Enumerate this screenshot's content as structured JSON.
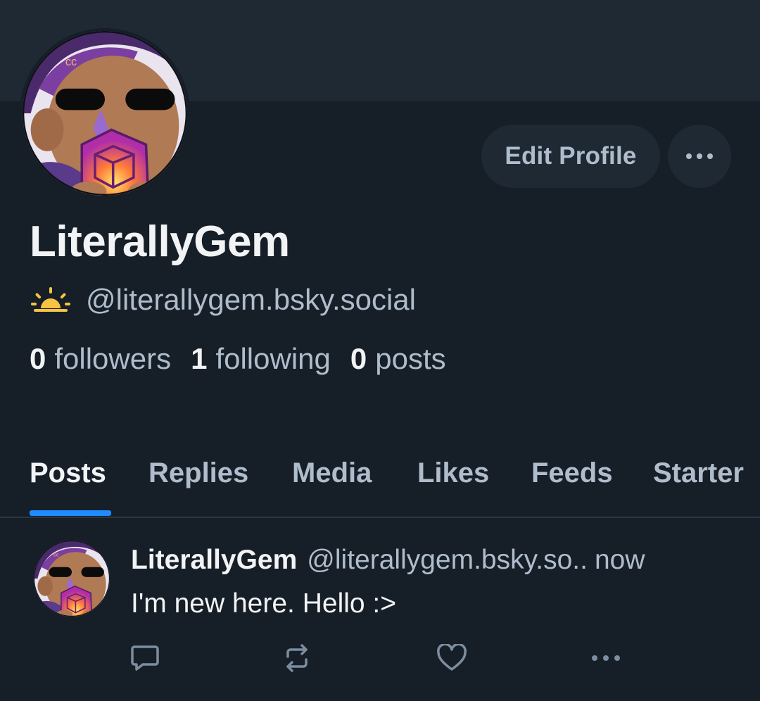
{
  "profile": {
    "display_name": "LiterallyGem",
    "handle": "@literallygem.bsky.social",
    "handle_emoji": "sunrise-icon",
    "edit_button_label": "Edit Profile",
    "more_button_icon": "ellipsis-icon"
  },
  "stats": {
    "followers_count": "0",
    "followers_label": "followers",
    "following_count": "1",
    "following_label": "following",
    "posts_count": "0",
    "posts_label": "posts"
  },
  "tabs": [
    {
      "label": "Posts",
      "active": true
    },
    {
      "label": "Replies",
      "active": false
    },
    {
      "label": "Media",
      "active": false
    },
    {
      "label": "Likes",
      "active": false
    },
    {
      "label": "Feeds",
      "active": false
    },
    {
      "label": "Starter",
      "active": false
    }
  ],
  "post": {
    "author_name": "LiterallyGem",
    "author_handle": "@literallygem.bsky.so..",
    "time": "now",
    "text": "I'm new here. Hello :>",
    "actions": [
      "reply-icon",
      "repost-icon",
      "like-icon",
      "more-icon"
    ]
  },
  "colors": {
    "background": "#161e27",
    "banner": "#1e2934",
    "accent": "#208bfe",
    "text_primary": "#f1f3f5",
    "text_secondary": "#aebccb"
  }
}
